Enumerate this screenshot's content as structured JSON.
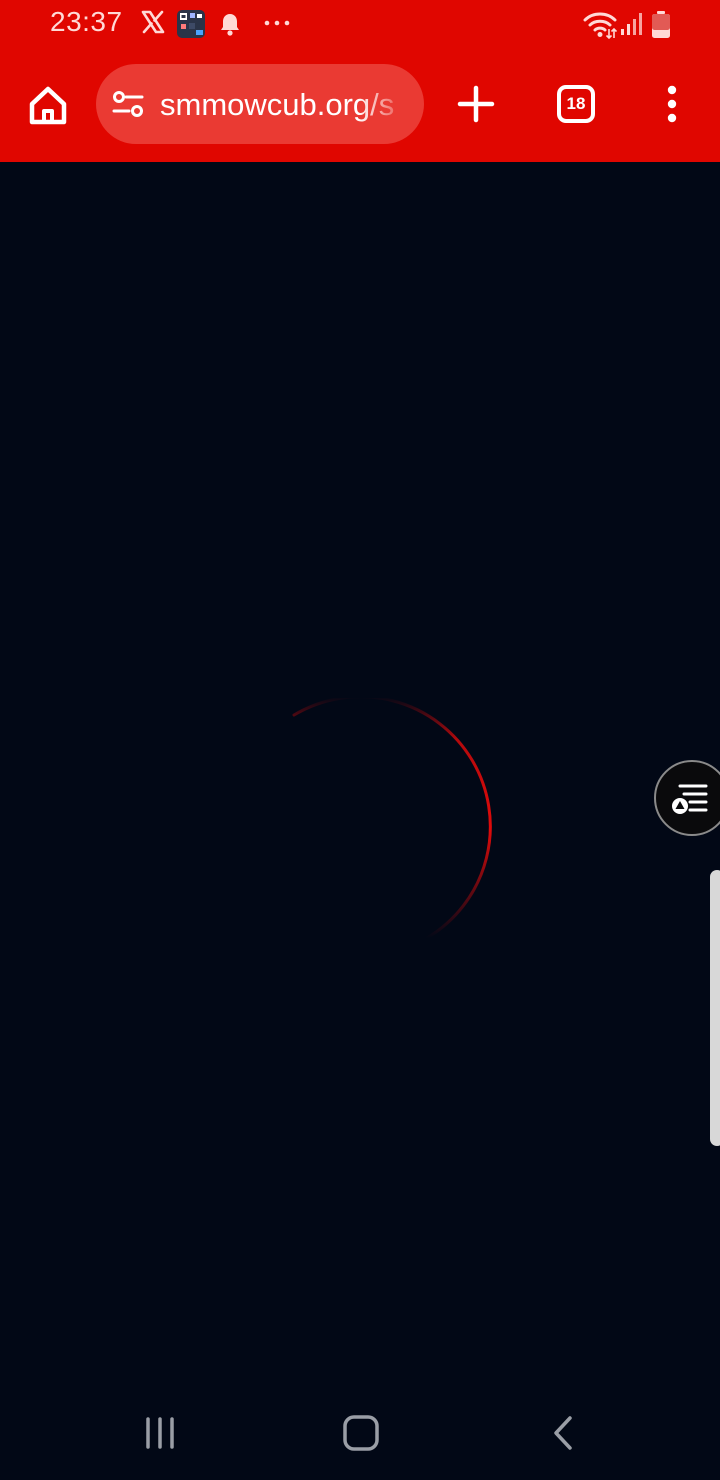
{
  "status_bar": {
    "time": "23:37",
    "icons": [
      "x-icon",
      "app-notification-icon",
      "bell-icon",
      "more-dots-icon",
      "wifi-icon",
      "signal-icon",
      "battery-low-icon"
    ]
  },
  "browser": {
    "url": "smmowcub.org/s",
    "tab_count": "18",
    "toolbar_icons": [
      "home-icon",
      "site-settings-icon",
      "plus-icon",
      "more-vertical-icon"
    ]
  },
  "page": {
    "state": "loading",
    "spinner_icon": "loading-spinner"
  },
  "nav_bar": {
    "icons": [
      "recents-icon",
      "home-icon",
      "back-icon"
    ]
  },
  "colors": {
    "brand_red": "#e00600",
    "url_bar": "#ea3a33",
    "page_background": "#020816",
    "spinner": "#e00a0a"
  }
}
